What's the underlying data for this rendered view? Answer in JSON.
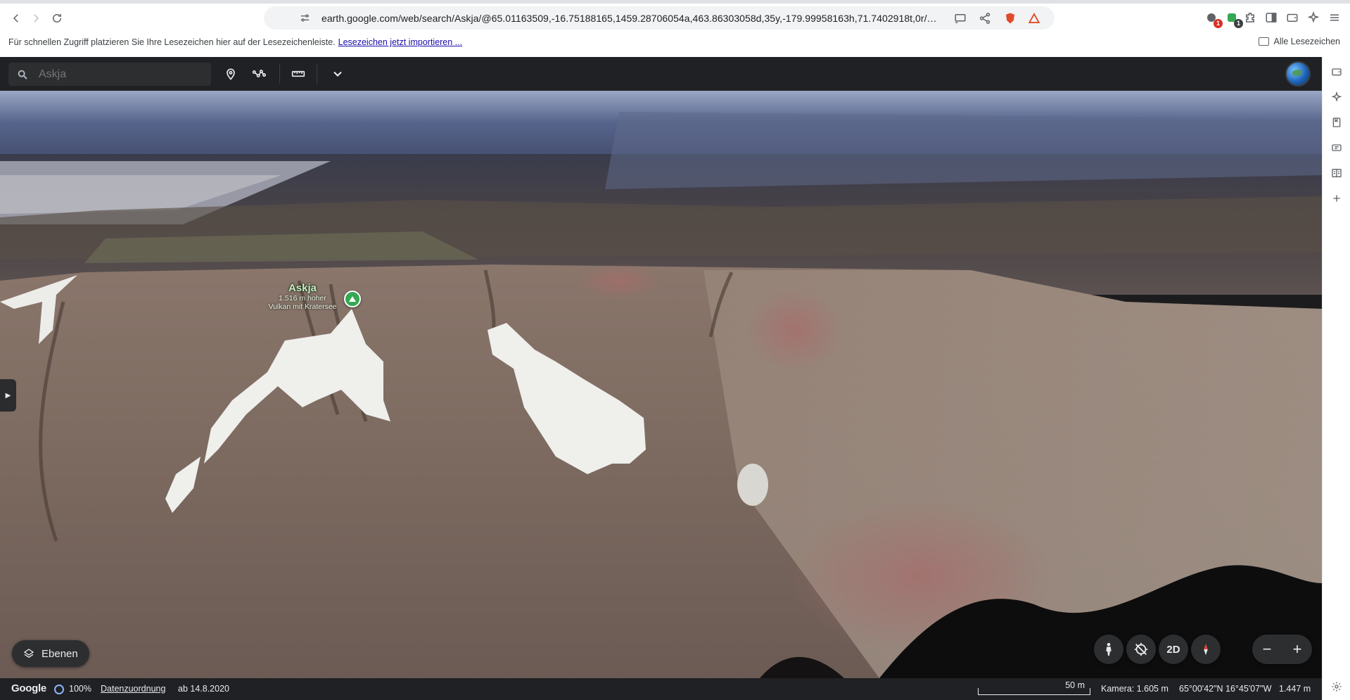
{
  "browser": {
    "url": "earth.google.com/web/search/Askja/@65.01163509,-16.75188165,1459.28706054a,463.86303058d,35y,-179.99958163h,71.7402918t,0r/d...",
    "bookmarks_hint": "Für schnellen Zugriff platzieren Sie Ihre Lesezeichen hier auf der Lesezeichenleiste.",
    "bookmarks_import": "Lesezeichen jetzt importieren ...",
    "all_bookmarks": "Alle Lesezeichen",
    "extension_badges": [
      "1",
      "1"
    ]
  },
  "earth": {
    "search_placeholder": "Askja",
    "search_value": "",
    "place": {
      "name": "Askja",
      "description_line1": "1.516 m hoher",
      "description_line2": "Vulkan mit Kratersee"
    },
    "layers_label": "Ebenen",
    "view_mode": "2D",
    "status": {
      "logo": "Google",
      "loading": "100%",
      "attribution": "Datenzuordnung",
      "imagery_date": "ab 14.8.2020",
      "scale": "50 m",
      "camera": "Kamera: 1.605 m",
      "coordinates": "65°00'42\"N 16°45'07\"W",
      "elevation": "1.447 m"
    }
  },
  "colors": {
    "toolbar": "#202124",
    "marker": "#35a853",
    "label": "#c7f0c2"
  },
  "icons": {
    "back": "arrow-left-icon",
    "forward": "arrow-right-icon",
    "reload": "reload-icon",
    "bookmark": "bookmark-icon",
    "site": "site-settings-icon",
    "pegman": "pegman-icon",
    "compass": "compass-icon"
  }
}
